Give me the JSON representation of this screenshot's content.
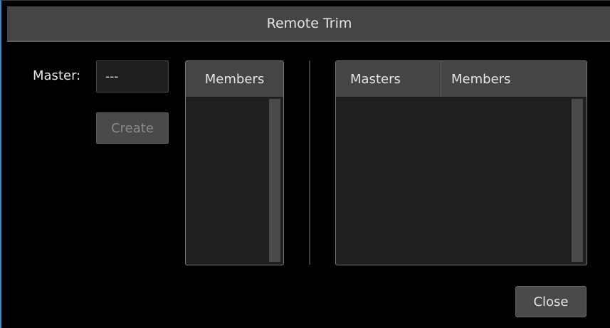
{
  "window": {
    "title": "Remote Trim"
  },
  "form": {
    "master_label": "Master:",
    "master_value": "---",
    "create_label": "Create"
  },
  "members_list": {
    "header": "Members"
  },
  "groups_table": {
    "headers": [
      "Masters",
      "Members"
    ]
  },
  "footer": {
    "close_label": "Close"
  },
  "colors": {
    "accent": "#2f8fd8",
    "background": "#000000",
    "header": "#454545"
  }
}
